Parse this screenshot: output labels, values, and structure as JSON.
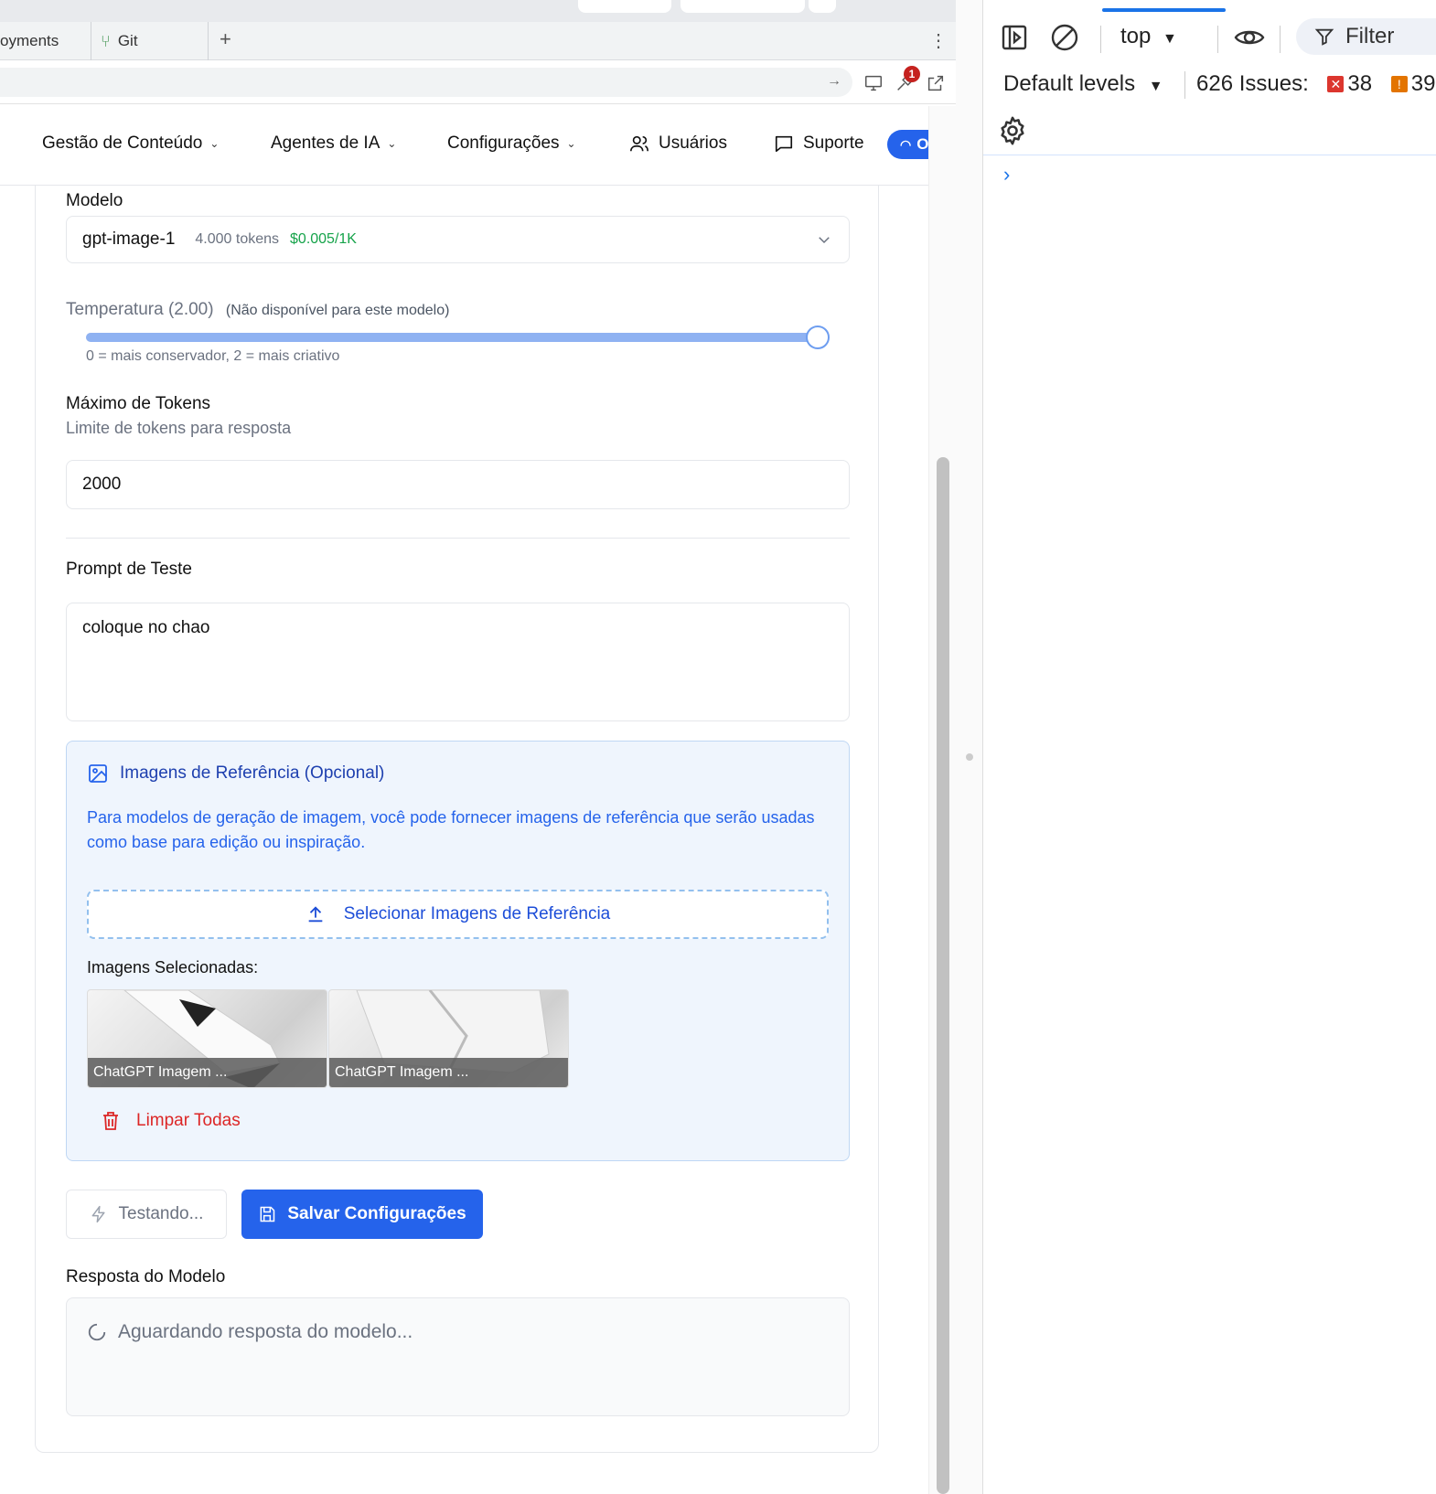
{
  "browser": {
    "tabs": [
      {
        "label": "oyments"
      },
      {
        "label": "Git",
        "icon": "git-branch-icon"
      }
    ],
    "new_tab_label": "+",
    "menu_label": "⋮",
    "devtools_badge": "1"
  },
  "nav": {
    "items": [
      {
        "label": "Gestão de Conteúdo",
        "dropdown": true
      },
      {
        "label": "Agentes de IA",
        "dropdown": true
      },
      {
        "label": "Configurações",
        "dropdown": true
      },
      {
        "label": "Usuários",
        "icon": "users-icon"
      },
      {
        "label": "Suporte",
        "icon": "message-icon"
      }
    ],
    "status_pill": "O",
    "colors": {
      "accent": "#2563eb"
    }
  },
  "form": {
    "model": {
      "label": "Modelo",
      "value": "gpt-image-1",
      "tokens": "4.000 tokens",
      "price": "$0.005/1K"
    },
    "temperature": {
      "label": "Temperatura (2.00)",
      "note": "(Não disponível para este modelo)",
      "value": 2.0,
      "min": 0,
      "max": 2,
      "hint": "0 = mais conservador, 2 = mais criativo"
    },
    "max_tokens": {
      "label": "Máximo de Tokens",
      "sublabel": "Limite de tokens para resposta",
      "value": "2000"
    },
    "prompt": {
      "label": "Prompt de Teste",
      "value": "coloque no chao"
    },
    "reference_images": {
      "title": "Imagens de Referência (Opcional)",
      "description": "Para modelos de geração de imagem, você pode fornecer imagens de referência que serão usadas como base para edição ou inspiração.",
      "upload_label": "Selecionar Imagens de Referência",
      "selected_label": "Imagens Selecionadas:",
      "images": [
        {
          "caption": "ChatGPT Imagem ..."
        },
        {
          "caption": "ChatGPT Imagem ..."
        }
      ],
      "clear_label": "Limpar Todas"
    },
    "buttons": {
      "test_label": "Testando...",
      "save_label": "Salvar Configurações"
    },
    "response": {
      "label": "Resposta do Modelo",
      "waiting": "Aguardando resposta do modelo..."
    }
  },
  "devtools": {
    "context": "top",
    "filter_label": "Filter",
    "levels_label": "Default levels",
    "issues_label": "626 Issues:",
    "errors": "38",
    "warnings": "39",
    "prompt_symbol": "›"
  }
}
